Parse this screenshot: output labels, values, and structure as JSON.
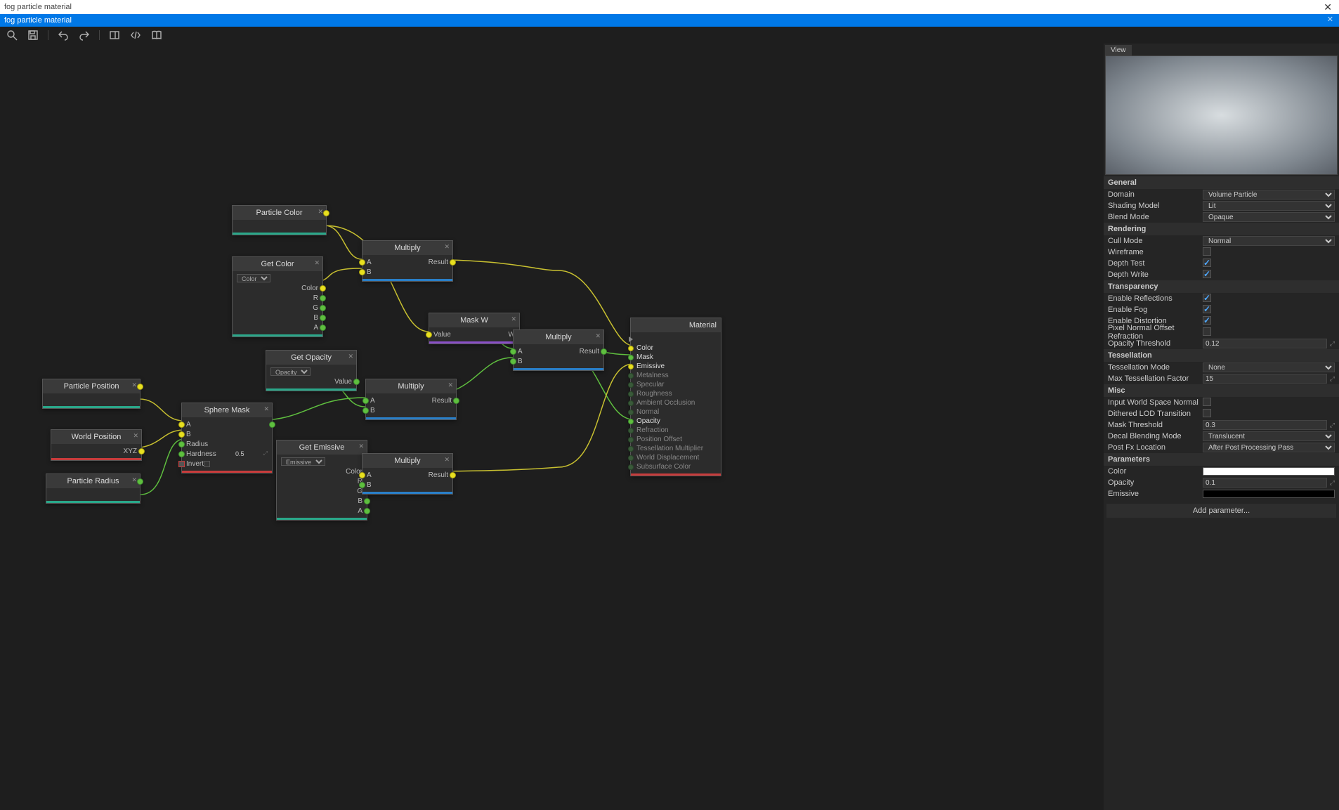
{
  "window": {
    "title": "fog particle material"
  },
  "tab": {
    "label": "fog particle material"
  },
  "nodes": {
    "particleColor": {
      "title": "Particle Color"
    },
    "getColor": {
      "title": "Get Color",
      "param": "Color",
      "out_color": "Color",
      "r": "R",
      "g": "G",
      "b": "B",
      "a": "A"
    },
    "getOpacity": {
      "title": "Get Opacity",
      "param": "Opacity",
      "out": "Value"
    },
    "getEmissive": {
      "title": "Get Emissive",
      "param": "Emissive",
      "out_color": "Color",
      "r": "R",
      "g": "G",
      "b": "B",
      "a": "A"
    },
    "multiply1": {
      "title": "Multiply",
      "a": "A",
      "b": "B",
      "res": "Result"
    },
    "multiply2": {
      "title": "Multiply",
      "a": "A",
      "b": "B",
      "res": "Result"
    },
    "multiply3": {
      "title": "Multiply",
      "a": "A",
      "b": "B",
      "res": "Result"
    },
    "multiply4": {
      "title": "Multiply",
      "a": "A",
      "b": "B",
      "res": "Result"
    },
    "maskW": {
      "title": "Mask W",
      "in": "Value",
      "out": "W"
    },
    "particlePos": {
      "title": "Particle Position"
    },
    "worldPos": {
      "title": "World Position",
      "xyz": "XYZ"
    },
    "particleRadius": {
      "title": "Particle Radius"
    },
    "sphereMask": {
      "title": "Sphere Mask",
      "a": "A",
      "b": "B",
      "radius": "Radius",
      "hardness": "Hardness",
      "hardval": "0.5",
      "invert": "Invert"
    },
    "material": {
      "title": "Material",
      "pins": [
        {
          "label": "Color",
          "active": true,
          "color": "yellow"
        },
        {
          "label": "Mask",
          "active": true,
          "color": "green"
        },
        {
          "label": "Emissive",
          "active": true,
          "color": "yellow"
        },
        {
          "label": "Metalness",
          "active": false,
          "color": "dim"
        },
        {
          "label": "Specular",
          "active": false,
          "color": "dim"
        },
        {
          "label": "Roughness",
          "active": false,
          "color": "dim"
        },
        {
          "label": "Ambient Occlusion",
          "active": false,
          "color": "dim"
        },
        {
          "label": "Normal",
          "active": false,
          "color": "dim"
        },
        {
          "label": "Opacity",
          "active": true,
          "color": "green"
        },
        {
          "label": "Refraction",
          "active": false,
          "color": "dim"
        },
        {
          "label": "Position Offset",
          "active": false,
          "color": "dim"
        },
        {
          "label": "Tessellation Multiplier",
          "active": false,
          "color": "dim"
        },
        {
          "label": "World Displacement",
          "active": false,
          "color": "dim"
        },
        {
          "label": "Subsurface Color",
          "active": false,
          "color": "dim"
        }
      ]
    }
  },
  "panel": {
    "viewTab": "View",
    "sections": {
      "general": {
        "title": "General",
        "domain_lbl": "Domain",
        "domain_val": "Volume Particle",
        "shading_lbl": "Shading Model",
        "shading_val": "Lit",
        "blend_lbl": "Blend Mode",
        "blend_val": "Opaque"
      },
      "rendering": {
        "title": "Rendering",
        "cull_lbl": "Cull Mode",
        "cull_val": "Normal",
        "wire_lbl": "Wireframe",
        "dtest_lbl": "Depth Test",
        "dwrite_lbl": "Depth Write"
      },
      "transparency": {
        "title": "Transparency",
        "refl_lbl": "Enable Reflections",
        "fog_lbl": "Enable Fog",
        "dist_lbl": "Enable Distortion",
        "pnor_lbl": "Pixel Normal Offset Refraction",
        "opth_lbl": "Opacity Threshold",
        "opth_val": "0.12"
      },
      "tessellation": {
        "title": "Tessellation",
        "mode_lbl": "Tessellation Mode",
        "mode_val": "None",
        "max_lbl": "Max Tessellation Factor",
        "max_val": "15"
      },
      "misc": {
        "title": "Misc",
        "iwsn_lbl": "Input World Space Normal",
        "dlod_lbl": "Dithered LOD Transition",
        "mth_lbl": "Mask Threshold",
        "mth_val": "0.3",
        "dbm_lbl": "Decal Blending Mode",
        "dbm_val": "Translucent",
        "pfx_lbl": "Post Fx Location",
        "pfx_val": "After Post Processing Pass"
      },
      "parameters": {
        "title": "Parameters",
        "color_lbl": "Color",
        "opacity_lbl": "Opacity",
        "opacity_val": "0.1",
        "emissive_lbl": "Emissive",
        "add": "Add parameter..."
      }
    }
  }
}
